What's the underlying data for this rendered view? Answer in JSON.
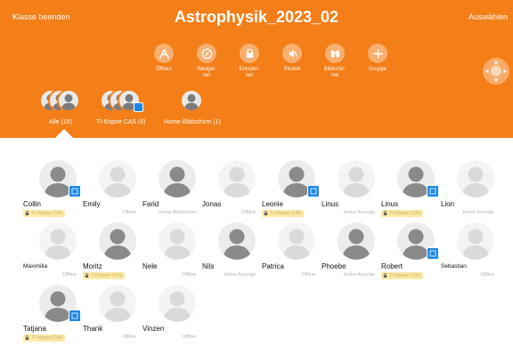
{
  "header": {
    "end_class": "Klasse beenden",
    "title": "Astrophysik_2023_02",
    "select": "Auswählen",
    "accent_color": "#f47e17"
  },
  "toolbar": [
    {
      "label": "Öffnen",
      "icon": "open-icon"
    },
    {
      "label": "Navigie-\nren",
      "icon": "navigate-icon"
    },
    {
      "label": "Entsper-\nren",
      "icon": "unlock-icon"
    },
    {
      "label": "Stumm",
      "icon": "mute-icon"
    },
    {
      "label": "Bildschir-\nme",
      "icon": "screens-icon"
    },
    {
      "label": "Gruppe",
      "icon": "plus-icon"
    }
  ],
  "groups": [
    {
      "label": "Alle (19)",
      "icon": "group-all-icon"
    },
    {
      "label": "TI-Nspire CAS (6)",
      "icon": "group-calculator-icon"
    },
    {
      "label": "Home-Bildschirm (1)",
      "icon": "group-home-icon"
    }
  ],
  "students": [
    {
      "name": "Collin",
      "status": "TI-Nspire CAS",
      "badge": true,
      "locked": true,
      "online": true
    },
    {
      "name": "Emily",
      "status": "Offline",
      "badge": false,
      "locked": false,
      "online": false
    },
    {
      "name": "Farid",
      "status": "Home-Bildschirm",
      "badge": false,
      "locked": false,
      "online": true
    },
    {
      "name": "Jonas",
      "status": "Offline",
      "badge": false,
      "locked": false,
      "online": false
    },
    {
      "name": "Leonie",
      "status": "TI-Nspire CAS",
      "badge": true,
      "locked": true,
      "online": true
    },
    {
      "name": "Linus",
      "status": "Keine Anzeige",
      "badge": false,
      "locked": false,
      "online": false
    },
    {
      "name": "Linus",
      "status": "TI-Nspire CAS",
      "badge": true,
      "locked": true,
      "online": true
    },
    {
      "name": "Lion",
      "status": "Keine Anzeige",
      "badge": false,
      "locked": false,
      "online": false
    },
    {
      "name": "Maximilia",
      "status": "Offline",
      "badge": false,
      "locked": false,
      "online": false
    },
    {
      "name": "Moritz",
      "status": "TI-Nspire CAS",
      "badge": false,
      "locked": true,
      "online": true
    },
    {
      "name": "Nele",
      "status": "Offline",
      "badge": false,
      "locked": false,
      "online": false
    },
    {
      "name": "Nils",
      "status": "Keine Anzeige",
      "badge": false,
      "locked": false,
      "online": true
    },
    {
      "name": "Patrica",
      "status": "Offline",
      "badge": false,
      "locked": false,
      "online": false
    },
    {
      "name": "Phoebe",
      "status": "Keine Anzeige",
      "badge": false,
      "locked": false,
      "online": true
    },
    {
      "name": "Robert",
      "status": "TI-Nspire CAS",
      "badge": true,
      "locked": true,
      "online": true
    },
    {
      "name": "Sebastian",
      "status": "Offline",
      "badge": false,
      "locked": false,
      "online": false
    },
    {
      "name": "Tatjana",
      "status": "TI-Nspire CAS",
      "badge": true,
      "locked": true,
      "online": true
    },
    {
      "name": "Thank",
      "status": "Offline",
      "badge": false,
      "locked": false,
      "online": false
    },
    {
      "name": "Vinzen",
      "status": "Offline",
      "badge": false,
      "locked": false,
      "online": false
    }
  ]
}
